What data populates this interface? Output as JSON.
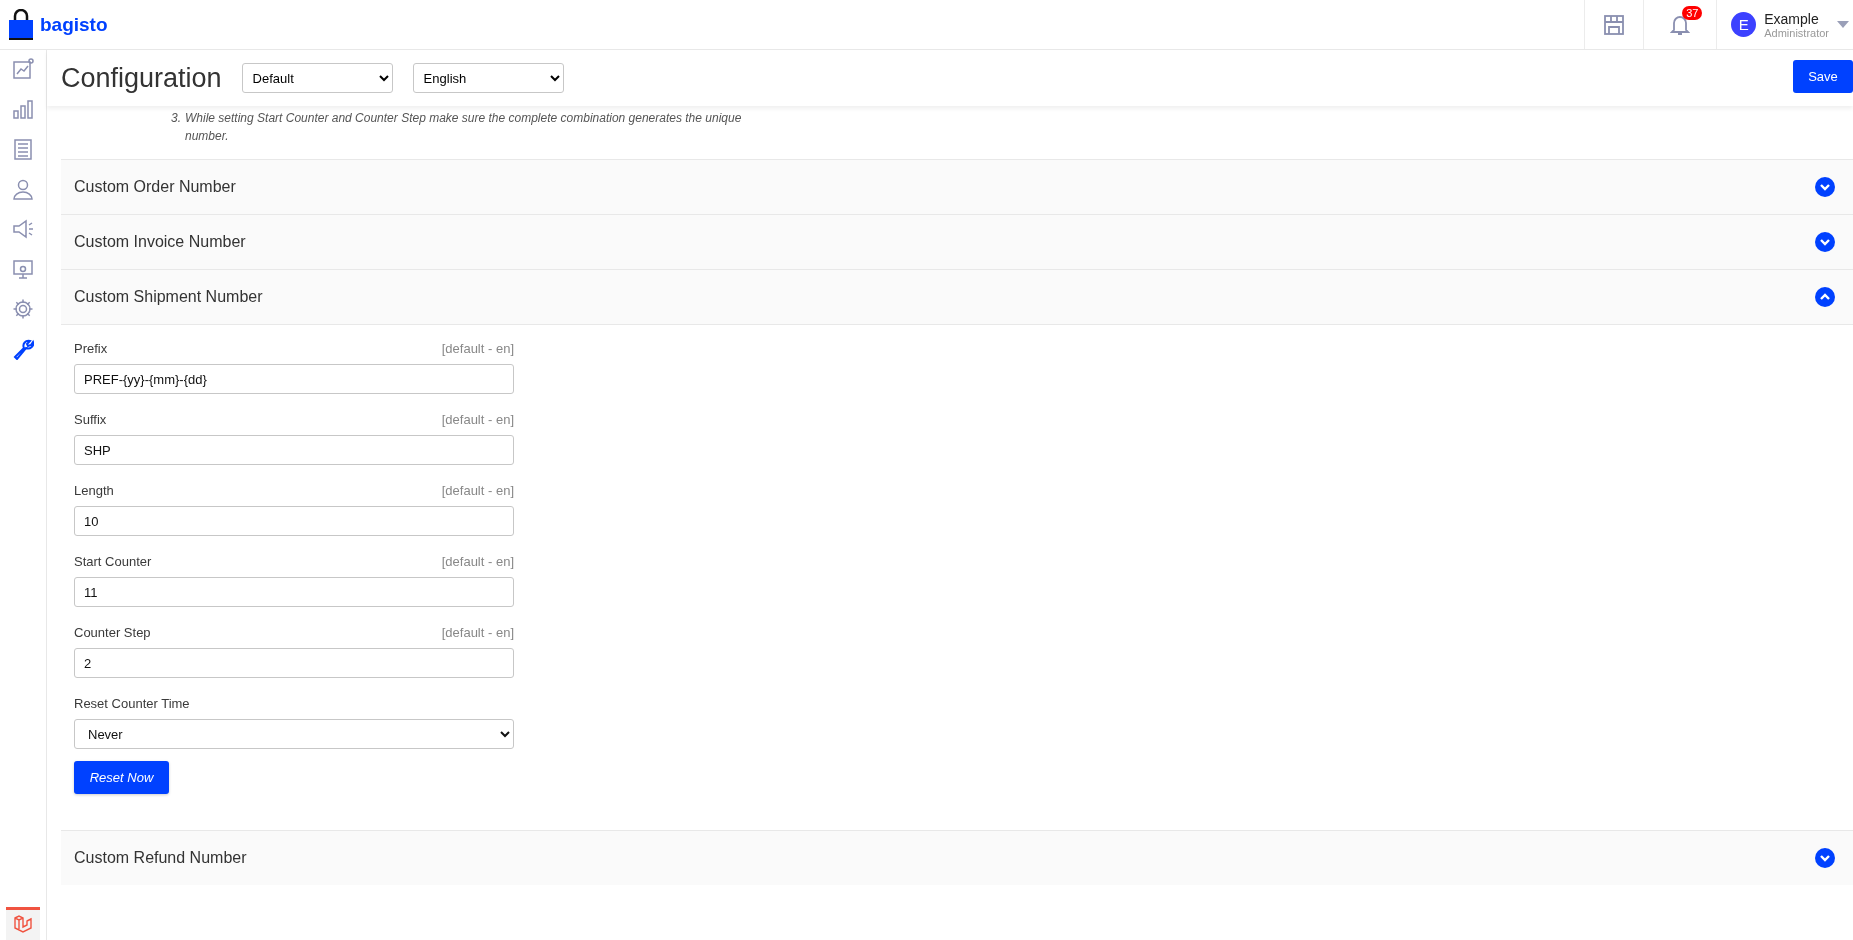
{
  "brand": {
    "name": "bagisto"
  },
  "topbar": {
    "notification_count": "37",
    "user": {
      "initial": "E",
      "name": "Example",
      "role": "Administrator"
    }
  },
  "sidebar": {
    "items": [
      {
        "kind": "dashboard",
        "selected": false
      },
      {
        "kind": "reports",
        "selected": false
      },
      {
        "kind": "catalog",
        "selected": false
      },
      {
        "kind": "customers",
        "selected": false
      },
      {
        "kind": "marketing",
        "selected": false
      },
      {
        "kind": "cms",
        "selected": false
      },
      {
        "kind": "settings",
        "selected": false
      },
      {
        "kind": "configuration",
        "selected": true
      }
    ]
  },
  "header": {
    "title": "Configuration",
    "channel": "Default",
    "locale": "English",
    "save": "Save"
  },
  "note": {
    "number": "3.",
    "text": "While setting Start Counter and Counter Step make sure the complete combination generates the unique number."
  },
  "sections": [
    {
      "title": "Custom Order Number",
      "expanded": false
    },
    {
      "title": "Custom Invoice Number",
      "expanded": false
    },
    {
      "title": "Custom Shipment Number",
      "expanded": true,
      "fields": [
        {
          "kind": "text",
          "label": "Prefix",
          "scope": "[default - en]",
          "value": "PREF-{yy}-{mm}-{dd}"
        },
        {
          "kind": "text",
          "label": "Suffix",
          "scope": "[default - en]",
          "value": "SHP"
        },
        {
          "kind": "text",
          "label": "Length",
          "scope": "[default - en]",
          "value": "10"
        },
        {
          "kind": "text",
          "label": "Start Counter",
          "scope": "[default - en]",
          "value": "11"
        },
        {
          "kind": "text",
          "label": "Counter Step",
          "scope": "[default - en]",
          "value": "2"
        },
        {
          "kind": "select",
          "label": "Reset Counter Time",
          "value": "Never"
        }
      ],
      "button": "Reset Now"
    },
    {
      "title": "Custom Refund Number",
      "expanded": false
    }
  ]
}
